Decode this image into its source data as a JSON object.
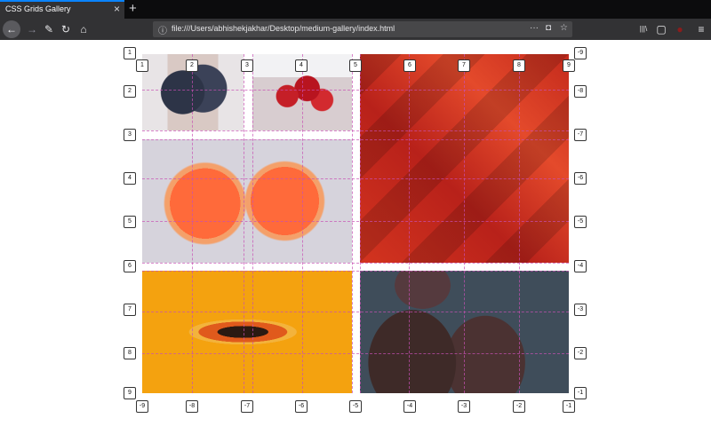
{
  "tab": {
    "title": "CSS Grids Gallery",
    "close": "×"
  },
  "toolbar": {
    "new_tab": "+",
    "back": "←",
    "forward": "→",
    "tools": "✎",
    "reload": "↻",
    "home": "⌂"
  },
  "url": {
    "info": "ⓘ",
    "text": "file:///Users/abhishekjakhar/Desktop/medium-gallery/index.html",
    "more": "···",
    "pocket": "◘",
    "bookmark": "☆"
  },
  "right_toolbar": {
    "library": "|||\\",
    "sidebar": "▢",
    "extension": "●",
    "menu": "≡"
  },
  "grid_labels": {
    "top": [
      "1",
      "2",
      "3",
      "4",
      "5",
      "6",
      "7",
      "8",
      "9"
    ],
    "bottom": [
      "-9",
      "-8",
      "-7",
      "-6",
      "-5",
      "-4",
      "-3",
      "-2",
      "-1"
    ],
    "left": [
      "1",
      "2",
      "3",
      "4",
      "5",
      "6",
      "7",
      "8",
      "9"
    ],
    "right": [
      "-9",
      "-8",
      "-7",
      "-6",
      "-5",
      "-4",
      "-3",
      "-2",
      "-1"
    ]
  },
  "colors": {
    "tab_accent": "#0a84ff",
    "grid_overlay": "#c850b4"
  }
}
